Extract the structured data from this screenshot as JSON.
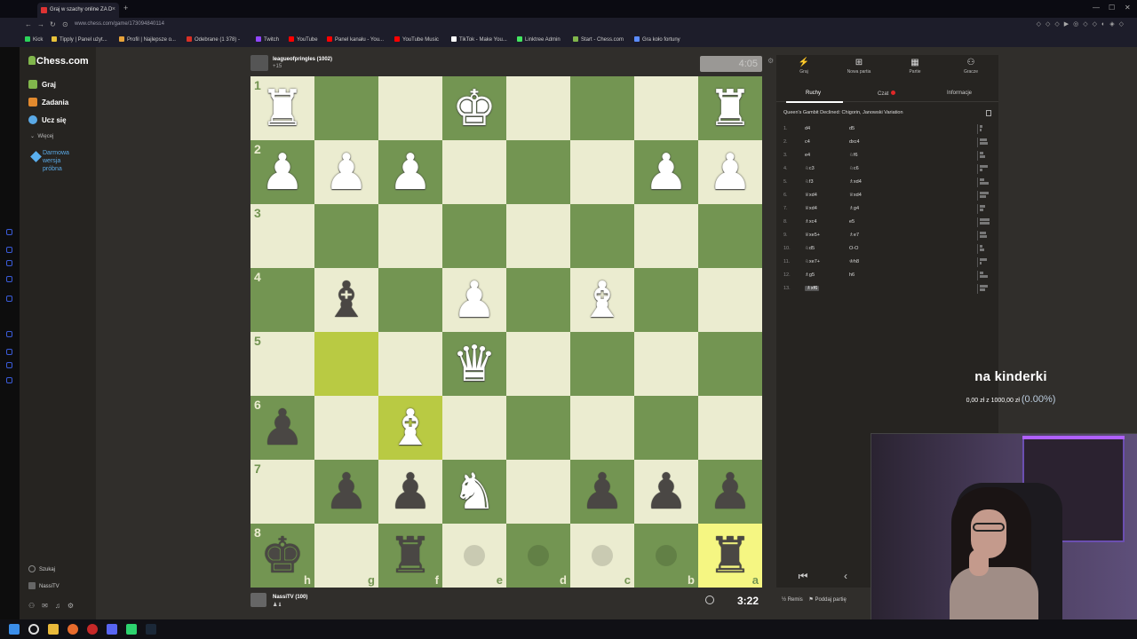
{
  "browser": {
    "tab_title": "Graj w szachy online ZA D",
    "url": "www.chess.com/game/173094840114",
    "bookmarks": [
      "Kick",
      "Tipply | Panel użyt...",
      "Profil | Najlepsze o...",
      "Odebrane (1 378) -",
      "Twitch",
      "YouTube",
      "Panel kanału - You...",
      "YouTube Music",
      "TikTok - Make You...",
      "Linktree Admin",
      "Start - Chess.com",
      "Gra koło fortuny"
    ],
    "bookmark_colors": [
      "#2bd35a",
      "#e8c23a",
      "#e8a33a",
      "#d93025",
      "#9146ff",
      "#ff0000",
      "#ff0000",
      "#ff0000",
      "#ffffff",
      "#43e660",
      "#81b64c",
      "#5b8cff"
    ]
  },
  "sidebar": {
    "logo": "Chess.com",
    "items": [
      {
        "label": "Graj",
        "color": "#81b64c"
      },
      {
        "label": "Zadania",
        "color": "#e28a2e"
      },
      {
        "label": "Ucz się",
        "color": "#5aa9e6"
      }
    ],
    "more": "Więcej",
    "promo": [
      "Darmowa",
      "wersja",
      "próbna"
    ],
    "search": "Szukaj",
    "user": "NassiTV"
  },
  "top_player": {
    "name": "leagueofpringles (1002)",
    "sub": "+15",
    "clock": "4:05"
  },
  "bottom_player": {
    "name": "NassiTV (100)",
    "clock": "3:22"
  },
  "board": {
    "ranks": [
      "1",
      "2",
      "3",
      "4",
      "5",
      "6",
      "7",
      "8"
    ],
    "files": [
      "h",
      "g",
      "f",
      "e",
      "d",
      "c",
      "b",
      "a"
    ],
    "pieces": [
      {
        "row": 0,
        "col": 0,
        "glyph": "♜",
        "color": "w"
      },
      {
        "row": 0,
        "col": 3,
        "glyph": "♚",
        "color": "w"
      },
      {
        "row": 0,
        "col": 7,
        "glyph": "♜",
        "color": "w"
      },
      {
        "row": 1,
        "col": 0,
        "glyph": "♟",
        "color": "w"
      },
      {
        "row": 1,
        "col": 1,
        "glyph": "♟",
        "color": "w"
      },
      {
        "row": 1,
        "col": 2,
        "glyph": "♟",
        "color": "w"
      },
      {
        "row": 1,
        "col": 6,
        "glyph": "♟",
        "color": "w"
      },
      {
        "row": 1,
        "col": 7,
        "glyph": "♟",
        "color": "w"
      },
      {
        "row": 3,
        "col": 1,
        "glyph": "♝",
        "color": "b"
      },
      {
        "row": 3,
        "col": 3,
        "glyph": "♟",
        "color": "w"
      },
      {
        "row": 3,
        "col": 5,
        "glyph": "♝",
        "color": "w"
      },
      {
        "row": 4,
        "col": 3,
        "glyph": "♛",
        "color": "w"
      },
      {
        "row": 5,
        "col": 0,
        "glyph": "♟",
        "color": "b"
      },
      {
        "row": 5,
        "col": 2,
        "glyph": "♝",
        "color": "w"
      },
      {
        "row": 6,
        "col": 1,
        "glyph": "♟",
        "color": "b"
      },
      {
        "row": 6,
        "col": 2,
        "glyph": "♟",
        "color": "b"
      },
      {
        "row": 6,
        "col": 3,
        "glyph": "♞",
        "color": "w"
      },
      {
        "row": 6,
        "col": 5,
        "glyph": "♟",
        "color": "b"
      },
      {
        "row": 6,
        "col": 6,
        "glyph": "♟",
        "color": "b"
      },
      {
        "row": 6,
        "col": 7,
        "glyph": "♟",
        "color": "b"
      },
      {
        "row": 7,
        "col": 0,
        "glyph": "♚",
        "color": "b"
      },
      {
        "row": 7,
        "col": 2,
        "glyph": "♜",
        "color": "b"
      },
      {
        "row": 7,
        "col": 7,
        "glyph": "♜",
        "color": "b"
      }
    ],
    "highlights": [
      {
        "row": 4,
        "col": 1
      },
      {
        "row": 5,
        "col": 2
      },
      {
        "row": 7,
        "col": 7
      }
    ],
    "move_hints": [
      {
        "row": 7,
        "col": 3
      },
      {
        "row": 7,
        "col": 4
      },
      {
        "row": 7,
        "col": 5
      },
      {
        "row": 7,
        "col": 6
      }
    ]
  },
  "panel": {
    "tabs": [
      {
        "label": "Graj",
        "icon": "lightning-icon"
      },
      {
        "label": "Nowa partia",
        "icon": "plus-icon"
      },
      {
        "label": "Partie",
        "icon": "board-icon"
      },
      {
        "label": "Gracze",
        "icon": "players-icon"
      }
    ],
    "subtabs": [
      "Ruchy",
      "Czat",
      "Informacje"
    ],
    "opening": "Queen's Gambit Declined: Chigorin, Janowski Variation",
    "moves": [
      {
        "n": "1.",
        "w": "d4",
        "b": "d5"
      },
      {
        "n": "2.",
        "w": "c4",
        "b": "dxc4"
      },
      {
        "n": "3.",
        "w": "e4",
        "b": "♘f6"
      },
      {
        "n": "4.",
        "w": "♘c3",
        "b": "♘c6"
      },
      {
        "n": "5.",
        "w": "♘f3",
        "b": "♗xd4"
      },
      {
        "n": "6.",
        "w": "♕xd4",
        "b": "♕xd4"
      },
      {
        "n": "7.",
        "w": "♕xd4",
        "b": "♗g4"
      },
      {
        "n": "8.",
        "w": "♗xc4",
        "b": "e5"
      },
      {
        "n": "9.",
        "w": "♕xe5+",
        "b": "♗e7"
      },
      {
        "n": "10.",
        "w": "♘d5",
        "b": "O-O"
      },
      {
        "n": "11.",
        "w": "♘xe7+",
        "b": "♔h8"
      },
      {
        "n": "12.",
        "w": "♗g5",
        "b": "h6"
      },
      {
        "n": "13.",
        "w": "♗xf6",
        "b": ""
      }
    ],
    "actions": {
      "draw": "Remis",
      "resign": "Poddaj partię"
    }
  },
  "overlay": {
    "title": "na kinderki",
    "amount": "0,00 zł z 1000,00 zł",
    "percent": "(0.00%)"
  }
}
